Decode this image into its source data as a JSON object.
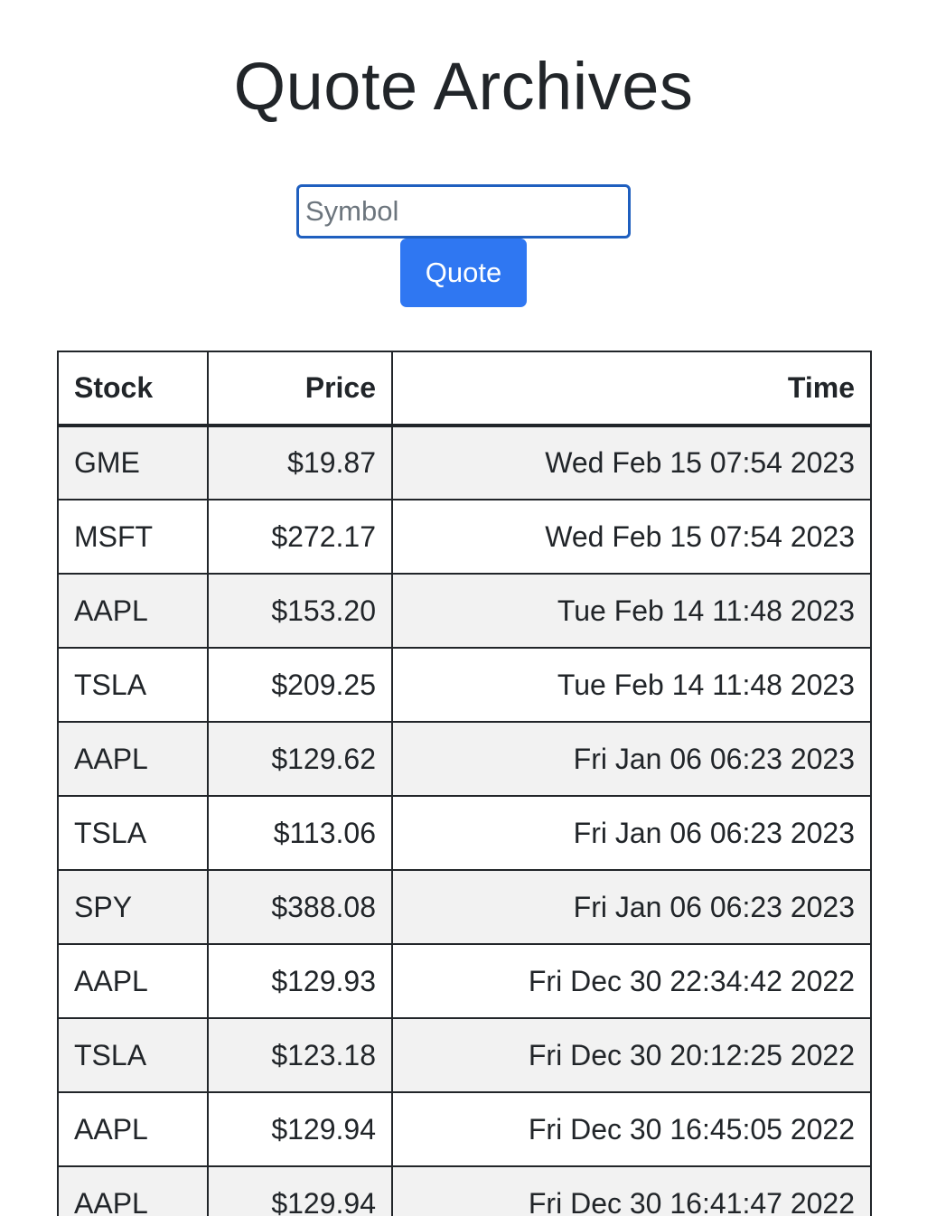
{
  "page": {
    "title": "Quote Archives"
  },
  "form": {
    "placeholder": "Symbol",
    "value": "",
    "button_label": "Quote"
  },
  "table": {
    "headers": {
      "stock": "Stock",
      "price": "Price",
      "time": "Time"
    },
    "rows": [
      {
        "stock": "GME",
        "price": "$19.87",
        "time": "Wed Feb 15 07:54 2023"
      },
      {
        "stock": "MSFT",
        "price": "$272.17",
        "time": "Wed Feb 15 07:54 2023"
      },
      {
        "stock": "AAPL",
        "price": "$153.20",
        "time": "Tue Feb 14 11:48 2023"
      },
      {
        "stock": "TSLA",
        "price": "$209.25",
        "time": "Tue Feb 14 11:48 2023"
      },
      {
        "stock": "AAPL",
        "price": "$129.62",
        "time": "Fri Jan 06 06:23 2023"
      },
      {
        "stock": "TSLA",
        "price": "$113.06",
        "time": "Fri Jan 06 06:23 2023"
      },
      {
        "stock": "SPY",
        "price": "$388.08",
        "time": "Fri Jan 06 06:23 2023"
      },
      {
        "stock": "AAPL",
        "price": "$129.93",
        "time": "Fri Dec 30 22:34:42 2022"
      },
      {
        "stock": "TSLA",
        "price": "$123.18",
        "time": "Fri Dec 30 20:12:25 2022"
      },
      {
        "stock": "AAPL",
        "price": "$129.94",
        "time": "Fri Dec 30 16:45:05 2022"
      },
      {
        "stock": "AAPL",
        "price": "$129.94",
        "time": "Fri Dec 30 16:41:47 2022"
      }
    ]
  },
  "colors": {
    "accent": "#2f77f2",
    "input_border": "#1f5fbf",
    "stripe": "#f2f2f2",
    "text": "#212529"
  }
}
